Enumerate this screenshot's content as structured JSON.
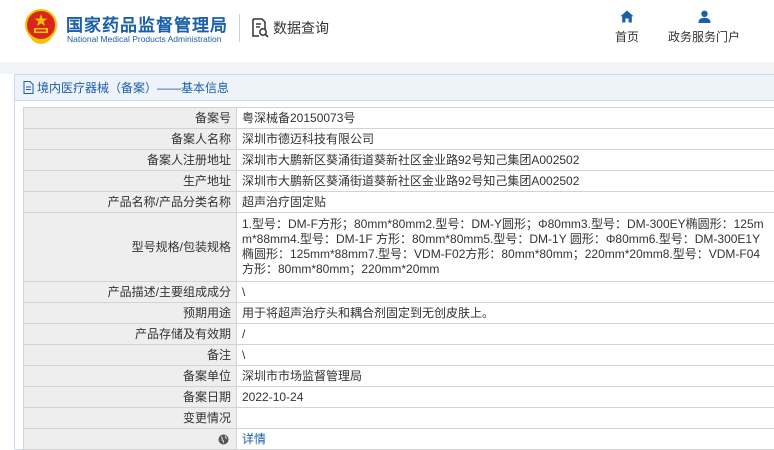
{
  "header": {
    "org_name_cn": "国家药品监督管理局",
    "org_name_en": "National Medical Products Administration",
    "query_label": "数据查询",
    "nav": [
      {
        "label": "首页",
        "icon": "home-icon"
      },
      {
        "label": "政务服务门户",
        "icon": "user-icon"
      }
    ]
  },
  "panel": {
    "title": "境内医疗器械（备案）——基本信息"
  },
  "rows": [
    {
      "label": "备案号",
      "value": "粤深械备20150073号"
    },
    {
      "label": "备案人名称",
      "value": "深圳市德迈科技有限公司"
    },
    {
      "label": "备案人注册地址",
      "value": "深圳市大鹏新区葵涌街道葵新社区金业路92号知己集团A002502"
    },
    {
      "label": "生产地址",
      "value": "深圳市大鹏新区葵涌街道葵新社区金业路92号知己集团A002502"
    },
    {
      "label": "产品名称/产品分类名称",
      "value": "超声治疗固定贴"
    },
    {
      "label": "型号规格/包装规格",
      "value": "1.型号：DM-F方形；80mm*80mm2.型号：DM-Y圆形；Φ80mm3.型号：DM-300EY椭圆形：125mm*88mm4.型号：DM-1F 方形：80mm*80mm5.型号：DM-1Y 圆形：Φ80mm6.型号：DM-300E1Y椭圆形：125mm*88mm7.型号：VDM-F02方形：80mm*80mm；220mm*20mm8.型号：VDM-F04方形：80mm*80mm；220mm*20mm"
    },
    {
      "label": "产品描述/主要组成成分",
      "value": "\\"
    },
    {
      "label": "预期用途",
      "value": "用于将超声治疗头和耦合剂固定到无创皮肤上。"
    },
    {
      "label": "产品存储及有效期",
      "value": "/"
    },
    {
      "label": "备注",
      "value": "\\"
    },
    {
      "label": "备案单位",
      "value": "深圳市市场监督管理局"
    },
    {
      "label": "备案日期",
      "value": "2022-10-24"
    },
    {
      "label": "变更情况",
      "value": ""
    },
    {
      "label": "",
      "value": "详情"
    }
  ],
  "colors": {
    "brand_blue": "#1a5fa8",
    "emblem_red": "#d9261c",
    "emblem_gold": "#f5c400"
  }
}
